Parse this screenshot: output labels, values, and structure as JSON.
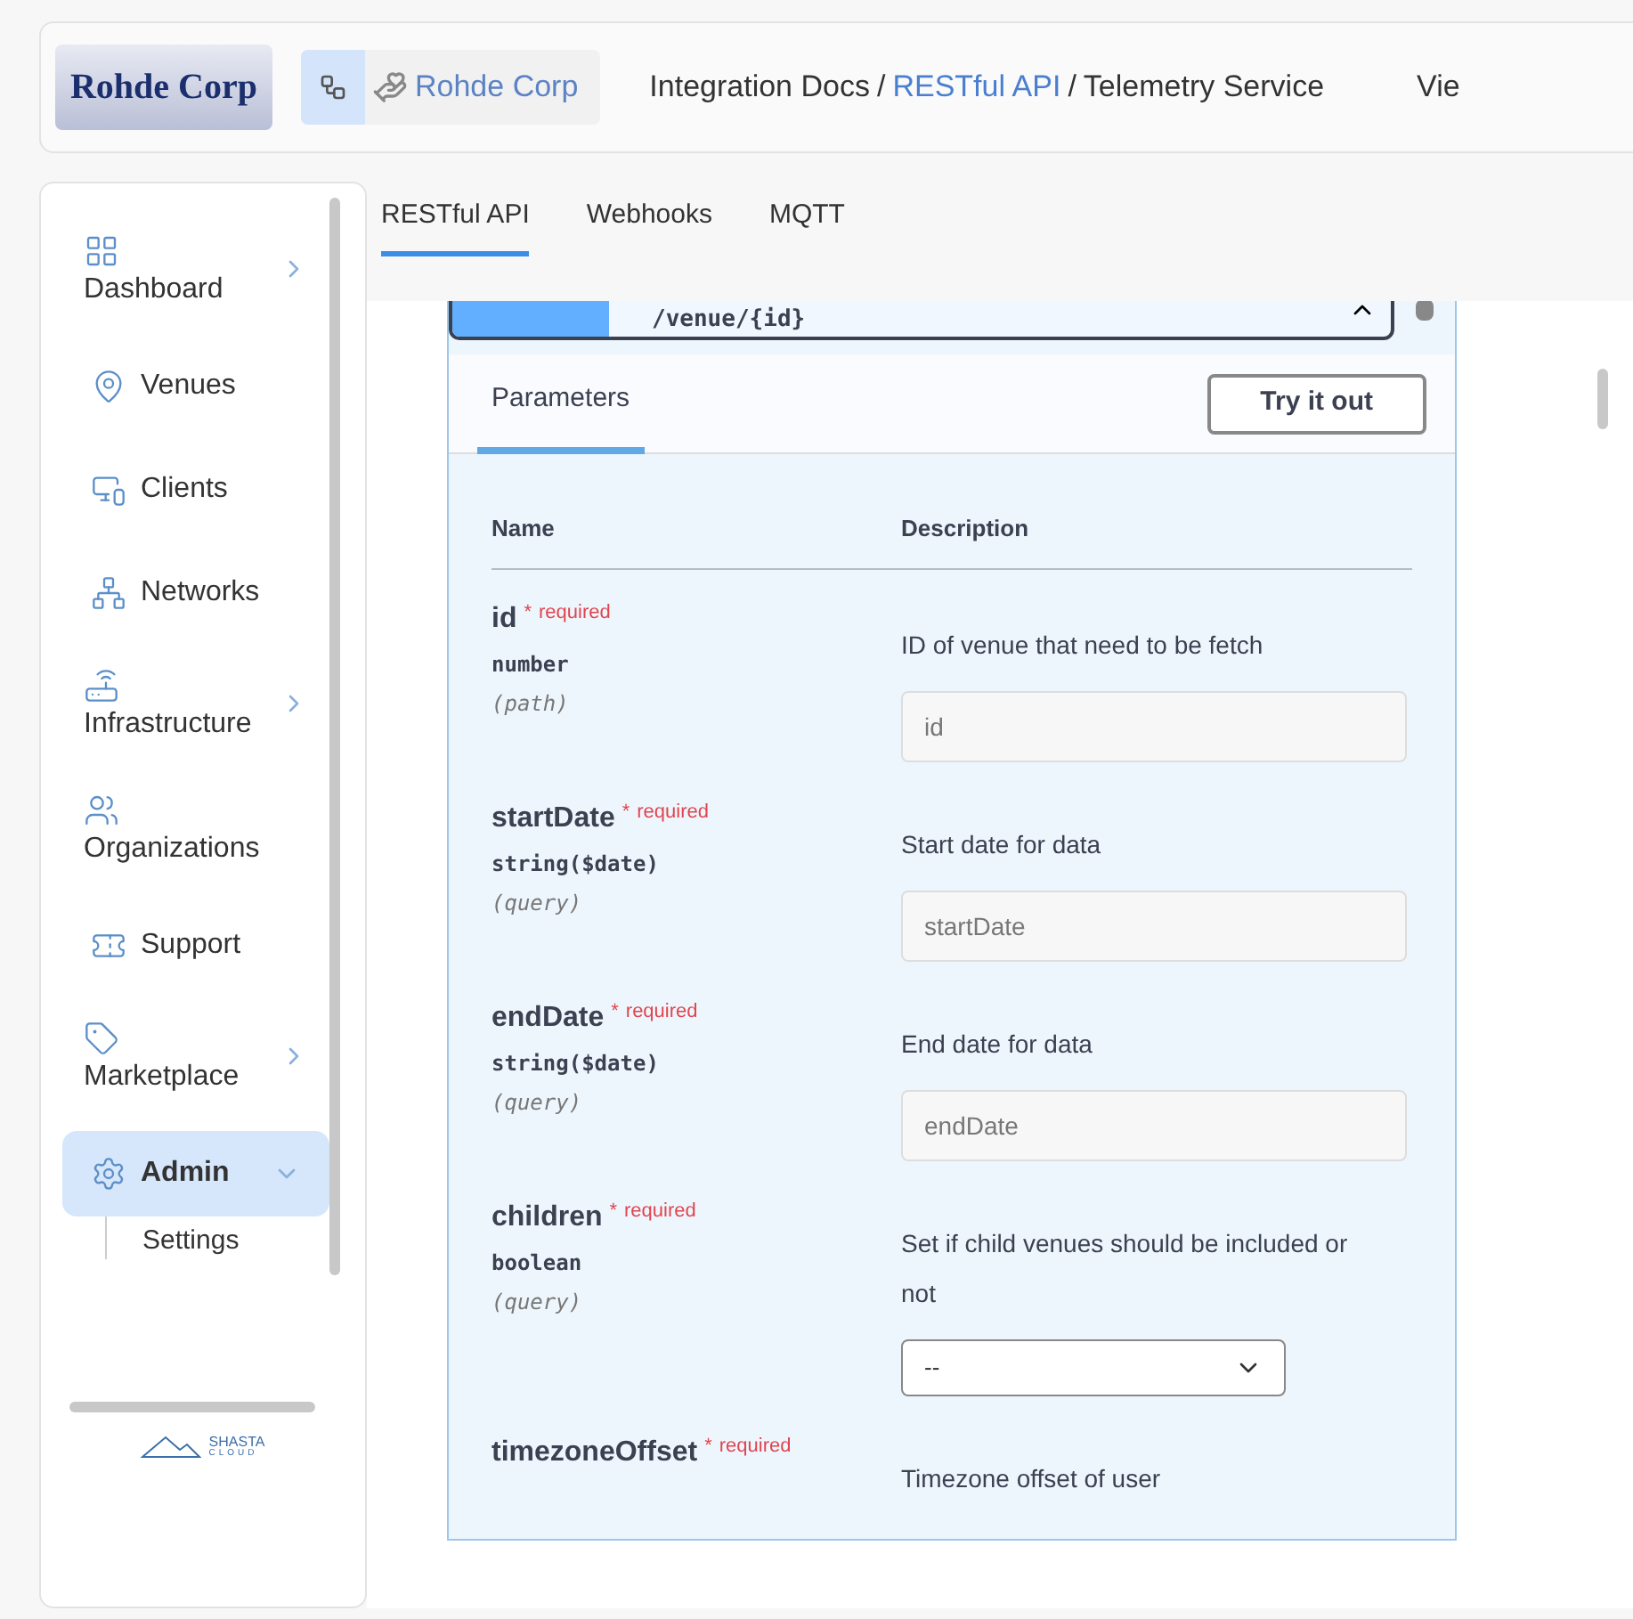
{
  "header": {
    "logo": "Rohde Corp",
    "org_name": "Rohde Corp",
    "breadcrumb": [
      {
        "label": "Integration Docs",
        "kind": "text"
      },
      {
        "label": "/",
        "kind": "separator"
      },
      {
        "label": "RESTful API",
        "kind": "link"
      },
      {
        "label": "/",
        "kind": "separator"
      },
      {
        "label": "Telemetry Service",
        "kind": "text"
      }
    ],
    "view_label": "Vie"
  },
  "sidebar": {
    "items": [
      {
        "label": "Dashboard",
        "kind": "stacked",
        "selected": false,
        "expanded": false
      },
      {
        "label": "Venues",
        "kind": "inline",
        "selected": false
      },
      {
        "label": "Clients",
        "kind": "inline",
        "selected": false
      },
      {
        "label": "Networks",
        "kind": "inline",
        "selected": false
      },
      {
        "label": "Infrastructure",
        "kind": "stacked",
        "selected": false,
        "expanded": false
      },
      {
        "label": "Organizations",
        "kind": "stacked_plain",
        "selected": false
      },
      {
        "label": "Support",
        "kind": "inline",
        "selected": false
      },
      {
        "label": "Marketplace",
        "kind": "stacked",
        "selected": false,
        "expanded": false
      },
      {
        "label": "Admin",
        "kind": "inline_expandable",
        "selected": true,
        "expanded": true,
        "children": [
          {
            "label": "Settings",
            "selected": false
          }
        ]
      }
    ],
    "footer_logo": "SHASTA",
    "footer_sub": "CLOUD"
  },
  "tabs": [
    {
      "label": "RESTful API",
      "selected": true
    },
    {
      "label": "Webhooks",
      "selected": false
    },
    {
      "label": "MQTT",
      "selected": false
    }
  ],
  "operation": {
    "path": "/venue/{id}",
    "section_tab": "Parameters",
    "try_button": "Try it out",
    "columns": [
      "Name",
      "Description"
    ],
    "parameters": [
      {
        "name": "id",
        "required_mark": "*",
        "required": "required",
        "type": "number",
        "location": "(path)",
        "description": "ID of venue that need to be fetch",
        "input": {
          "kind": "text",
          "placeholder": "id"
        }
      },
      {
        "name": "startDate",
        "required_mark": "*",
        "required": "required",
        "type": "string($date)",
        "location": "(query)",
        "description": "Start date for data",
        "input": {
          "kind": "text",
          "placeholder": "startDate"
        }
      },
      {
        "name": "endDate",
        "required_mark": "*",
        "required": "required",
        "type": "string($date)",
        "location": "(query)",
        "description": "End date for data",
        "input": {
          "kind": "text",
          "placeholder": "endDate"
        }
      },
      {
        "name": "children",
        "required_mark": "*",
        "required": "required",
        "type": "boolean",
        "location": "(query)",
        "description": "Set if child venues should be included or not",
        "input": {
          "kind": "select",
          "value": "--"
        }
      },
      {
        "name": "timezoneOffset",
        "required_mark": "*",
        "required": "required",
        "description": "Timezone offset of user"
      }
    ]
  }
}
